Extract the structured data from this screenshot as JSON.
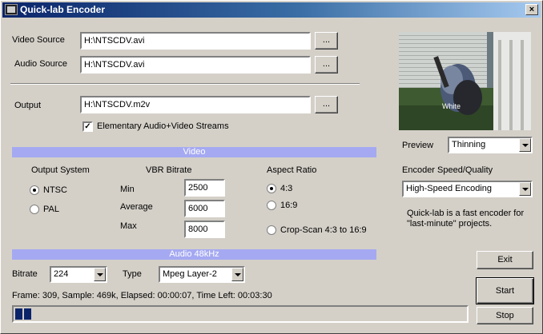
{
  "window": {
    "title": "Quick-lab Encoder",
    "close_label": "×"
  },
  "video_source": {
    "label": "Video Source",
    "value": "H:\\NTSCDV.avi",
    "browse": "..."
  },
  "audio_source": {
    "label": "Audio Source",
    "value": "H:\\NTSCDV.avi",
    "browse": "..."
  },
  "output": {
    "label": "Output",
    "value": "H:\\NTSCDV.m2v",
    "browse": "...",
    "elementary_label": "Elementary Audio+Video Streams",
    "elementary_checked": true
  },
  "preview": {
    "label": "Preview",
    "mode": "Thinning",
    "overlay_text": "White"
  },
  "encoder": {
    "label": "Encoder Speed/Quality",
    "mode": "High-Speed Encoding",
    "description": "Quick-lab is a fast encoder for \"last-minute\" projects."
  },
  "video": {
    "band_label": "Video",
    "output_system_label": "Output System",
    "ntsc_label": "NTSC",
    "pal_label": "PAL",
    "selected_system": "NTSC",
    "vbr_label": "VBR Bitrate",
    "min_label": "Min",
    "min_value": "2500",
    "avg_label": "Average",
    "avg_value": "6000",
    "max_label": "Max",
    "max_value": "8000",
    "aspect_label": "Aspect Ratio",
    "aspect_4_3": "4:3",
    "aspect_16_9": "16:9",
    "aspect_crop": "Crop-Scan 4:3 to 16:9",
    "selected_aspect": "4:3"
  },
  "audio": {
    "band_label": "Audio 48kHz",
    "bitrate_label": "Bitrate",
    "bitrate_value": "224",
    "type_label": "Type",
    "type_value": "Mpeg Layer-2"
  },
  "status": {
    "text": "Frame: 309, Sample: 469k, Elapsed: 00:00:07, Time Left: 00:03:30",
    "progress_fraction": 0.04
  },
  "buttons": {
    "exit": "Exit",
    "start": "Start",
    "stop": "Stop"
  },
  "colors": {
    "title_start": "#0a246a",
    "band": "#a5a9f2",
    "face": "#d4d0c8"
  }
}
